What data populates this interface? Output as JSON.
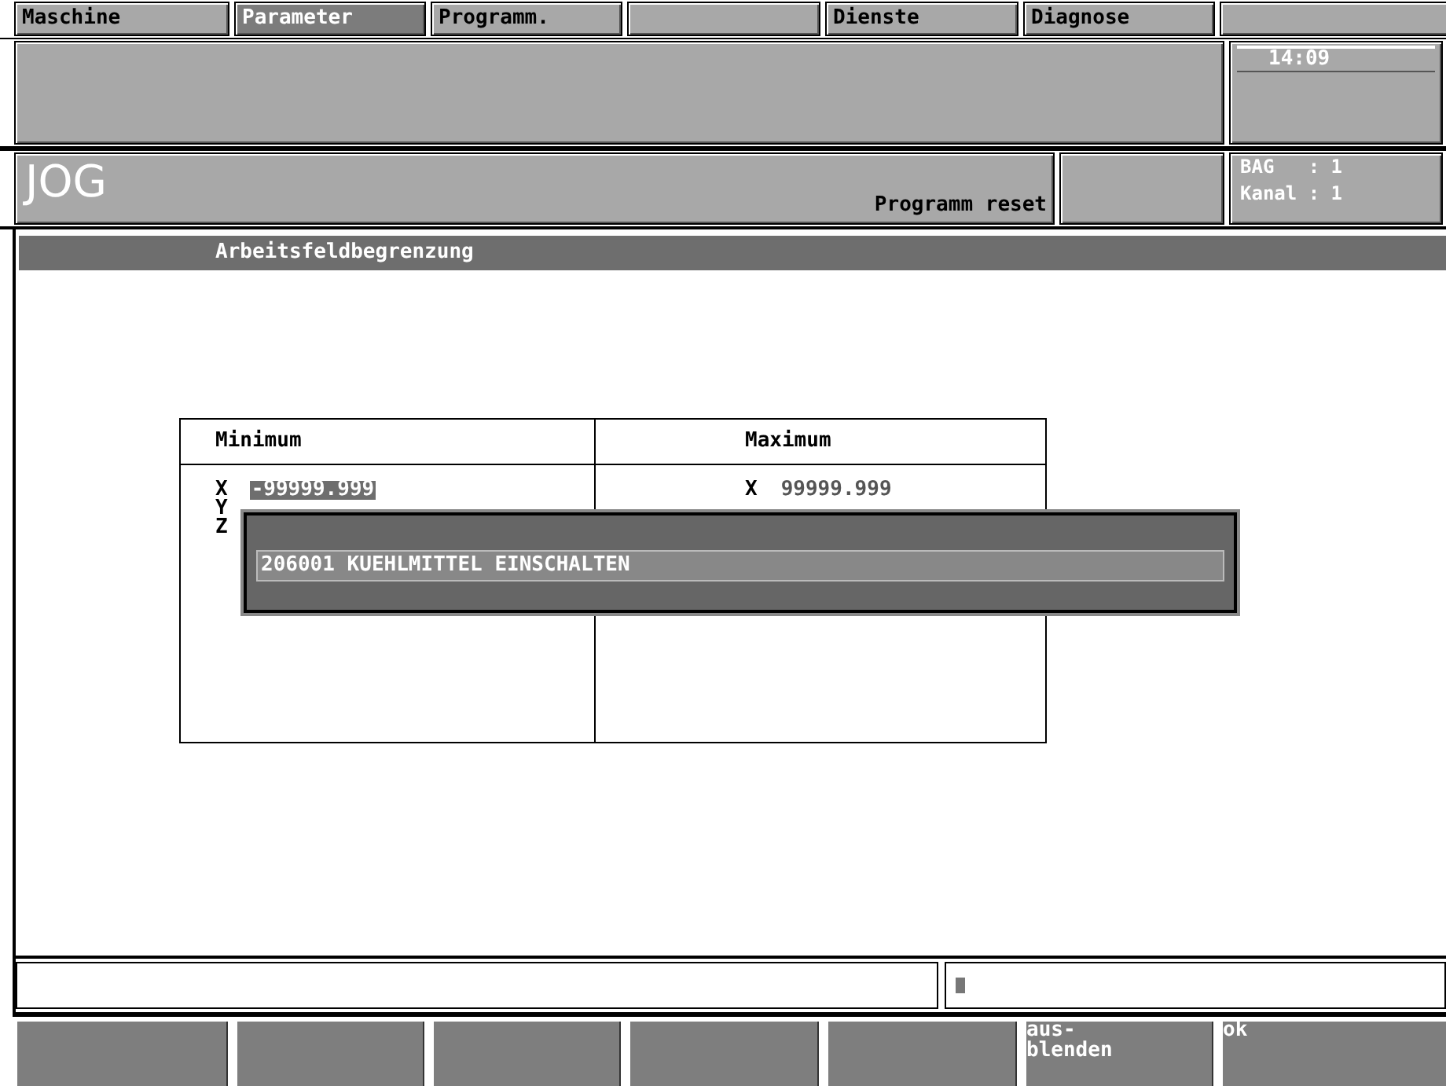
{
  "menu_tabs": [
    {
      "label": "Maschine",
      "selected": false
    },
    {
      "label": "Parameter",
      "selected": true
    },
    {
      "label": "Programm.",
      "selected": false
    },
    {
      "selected": false
    },
    {
      "label": "Dienste",
      "selected": false
    },
    {
      "label": "Diagnose",
      "selected": false
    },
    {
      "selected": false
    }
  ],
  "clock": "14:09",
  "status": {
    "mode": "JOG",
    "program_state": "Programm reset",
    "bag": "BAG   : 1",
    "kanal": "Kanal : 1"
  },
  "panel": {
    "title": "Arbeitsfeldbegrenzung",
    "columns": [
      {
        "heading": "Minimum",
        "rows": [
          {
            "axis": "X",
            "value": "-99999.999",
            "selected": true
          },
          {
            "axis": "Y"
          },
          {
            "axis": "Z"
          }
        ]
      },
      {
        "heading": "Maximum",
        "rows": [
          {
            "axis": "X",
            "value": "99999.999",
            "selected": false
          }
        ]
      }
    ]
  },
  "alarm": {
    "text": "206001  KUEHLMITTEL EINSCHALTEN"
  },
  "input_line": {
    "cursor": true
  },
  "softkeys": [
    {
      "label": "aus-\nblenden"
    },
    {
      "label": "ok"
    }
  ]
}
